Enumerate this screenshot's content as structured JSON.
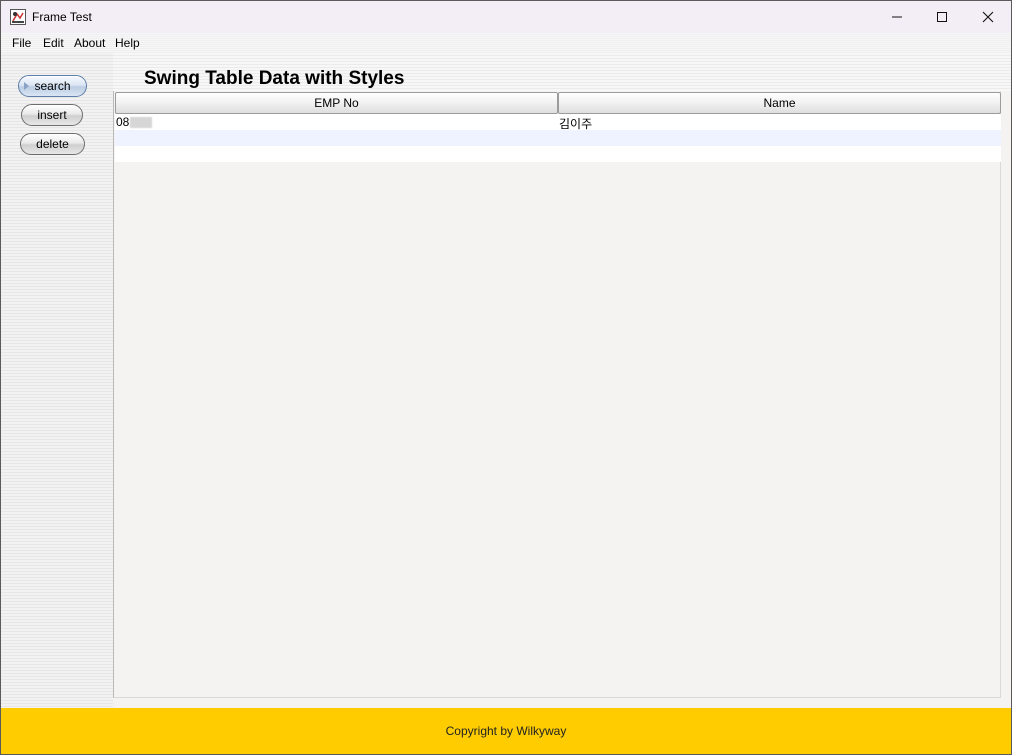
{
  "window": {
    "title": "Frame Test",
    "controls": [
      "minimize",
      "maximize",
      "close"
    ]
  },
  "menu": {
    "items": [
      {
        "label": "File"
      },
      {
        "label": "Edit"
      },
      {
        "label": "About"
      },
      {
        "label": "Help"
      }
    ]
  },
  "sidebar": {
    "buttons": [
      {
        "label": "search",
        "focused": true
      },
      {
        "label": "insert"
      },
      {
        "label": "delete"
      }
    ]
  },
  "main": {
    "title": "Swing Table Data with Styles",
    "table": {
      "columns": [
        "EMP No",
        "Name"
      ],
      "rows": [
        {
          "emp_no": "08",
          "name": "김이주"
        }
      ],
      "row_stripe_color": "#eef3ff"
    }
  },
  "footer": {
    "text": "Copyright by Wilkyway",
    "background": "#ffcc00"
  }
}
